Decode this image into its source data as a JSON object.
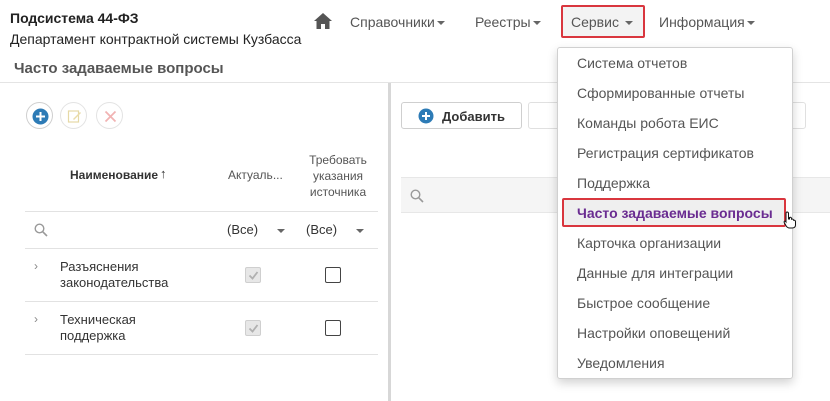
{
  "header": {
    "title": "Подсистема 44-ФЗ",
    "subtitle": "Департамент контрактной системы Кузбасса",
    "home_icon": "home-icon",
    "nav": [
      {
        "label": "Справочники"
      },
      {
        "label": "Реестры"
      },
      {
        "label": "Сервис"
      },
      {
        "label": "Информация"
      }
    ]
  },
  "page": {
    "title": "Часто задаваемые вопросы"
  },
  "left_grid": {
    "columns": {
      "name": "Наименование",
      "actual": "Актуаль...",
      "require_source": [
        "Требовать",
        "указания",
        "источника"
      ]
    },
    "filters": {
      "actual": "(Все)",
      "require_source": "(Все)"
    },
    "rows": [
      {
        "name_lines": [
          "Разъяснения",
          "законодательства"
        ],
        "actual": true,
        "require_source": false
      },
      {
        "name_lines": [
          "Техническая",
          "поддержка"
        ],
        "actual": true,
        "require_source": false
      }
    ]
  },
  "right_panel": {
    "add_label": "Добавить"
  },
  "service_menu": {
    "items": [
      "Система отчетов",
      "Сформированные отчеты",
      "Команды робота ЕИС",
      "Регистрация сертификатов",
      "Поддержка",
      "Часто задаваемые вопросы",
      "Карточка организации",
      "Данные для интеграции",
      "Быстрое сообщение",
      "Настройки оповещений",
      "Уведомления"
    ],
    "active_index": 5
  },
  "colors": {
    "highlight_border": "#d9363e",
    "active_text": "#6a2c91",
    "add_icon": "#2d7bb6"
  }
}
